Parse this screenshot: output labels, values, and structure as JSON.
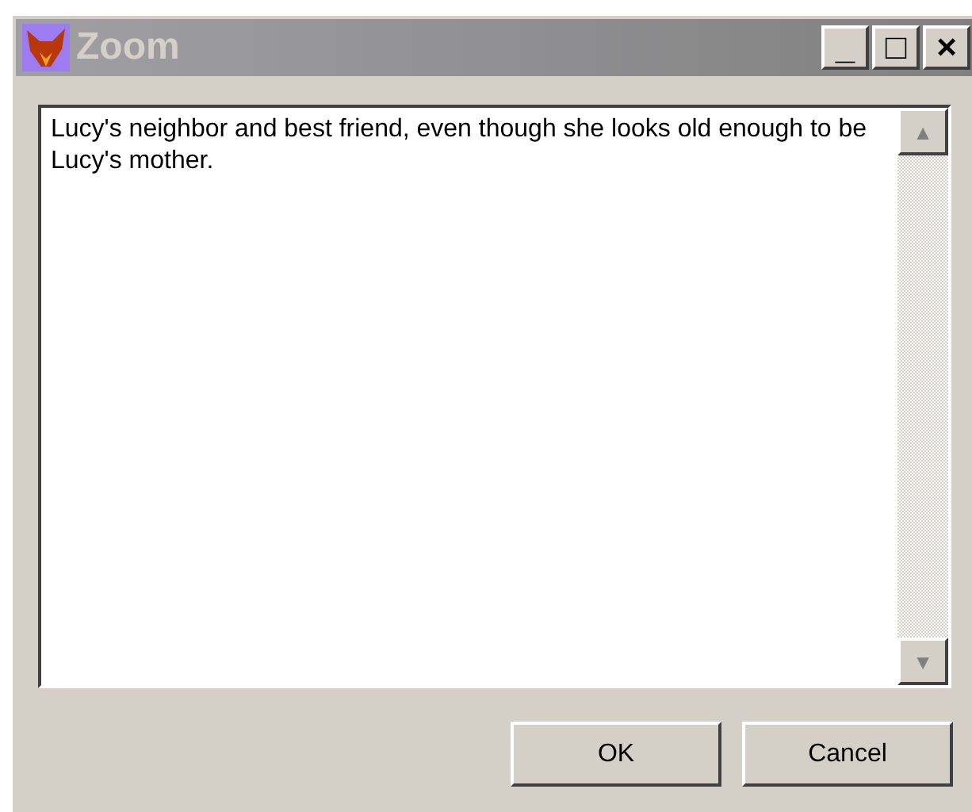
{
  "window": {
    "title": "Zoom",
    "controls": [
      "_",
      "□",
      "×"
    ]
  },
  "text_area": {
    "value": "Lucy's neighbor and best friend, even though she looks old enough to be Lucy's mother."
  },
  "scrollbar": {
    "up": "▲",
    "down": "▼"
  },
  "buttons": [
    "OK",
    "Cancel"
  ]
}
